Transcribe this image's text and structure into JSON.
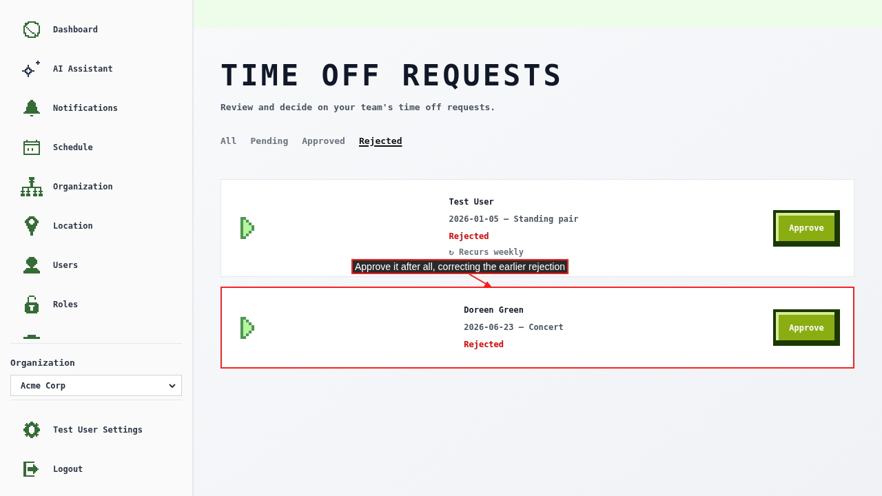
{
  "sidebar": {
    "nav_items": [
      {
        "kind": "link",
        "label": "Dashboard"
      },
      {
        "kind": "link",
        "label": "AI Assistant"
      },
      {
        "kind": "link",
        "label": "Notifications"
      },
      {
        "kind": "link",
        "label": "Schedule"
      },
      {
        "kind": "link",
        "label": "Organization"
      },
      {
        "kind": "link",
        "label": "Location"
      },
      {
        "kind": "link",
        "label": "Users"
      },
      {
        "kind": "link",
        "label": "Roles"
      },
      {
        "kind": "clipped"
      }
    ],
    "organization": {
      "label": "Organization",
      "value": "Acme Corp"
    },
    "footer_items": [
      {
        "label": "Test User Settings"
      },
      {
        "label": "Logout"
      }
    ]
  },
  "main": {
    "title": "TIME OFF REQUESTS",
    "subtitle": "Review and decide on your team's time off requests.",
    "tabs": [
      {
        "label": "All",
        "selected": false
      },
      {
        "label": "Pending",
        "selected": false
      },
      {
        "label": "Approved",
        "selected": false
      },
      {
        "label": "Rejected",
        "selected": true
      }
    ],
    "requests": [
      {
        "name": "Test User",
        "detail": "2026-01-05 – Standing pair",
        "status": "Rejected",
        "recurrence": "↻ Recurs weekly",
        "action": "Approve",
        "highlighted": false
      },
      {
        "name": "Doreen Green",
        "detail": "2026-06-23 – Concert",
        "status": "Rejected",
        "action": "Approve",
        "highlighted": true,
        "callout": "Approve it after all, correcting the earlier rejection"
      }
    ]
  }
}
